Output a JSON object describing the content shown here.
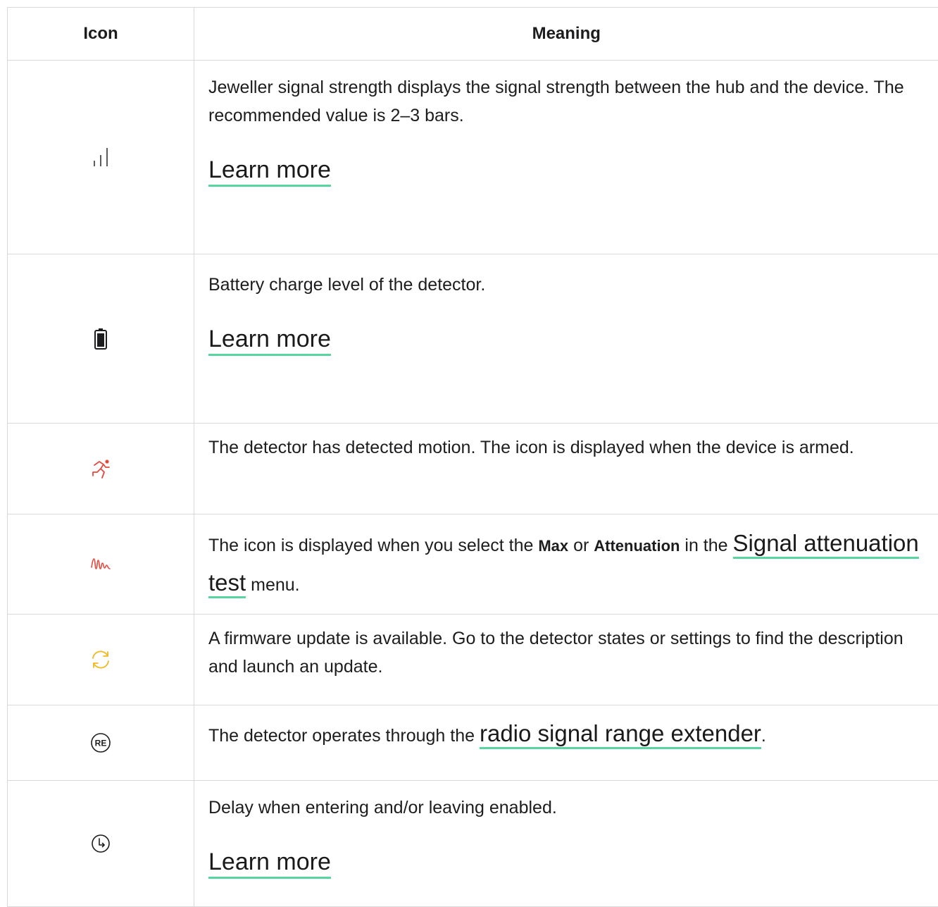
{
  "table": {
    "headers": {
      "icon": "Icon",
      "meaning": "Meaning"
    },
    "rows": [
      {
        "icon": "signal-strength-icon",
        "text": "Jeweller signal strength displays the signal strength between the hub and the device. The recommended value is 2–3 bars.",
        "link": "Learn more"
      },
      {
        "icon": "battery-icon",
        "text": "Battery charge level of the detector.",
        "link": "Learn more"
      },
      {
        "icon": "motion-detected-icon",
        "text": "The detector has detected motion. The icon is displayed when the device is armed."
      },
      {
        "icon": "signal-attenuation-icon",
        "text_before": "The icon is displayed when you select the ",
        "bold1": "Max",
        "text_middle": " or ",
        "bold2": "Attenuation",
        "text_after_bold": " in the ",
        "link": "Signal attenuation test",
        "text_end": " menu."
      },
      {
        "icon": "firmware-update-icon",
        "text": "A firmware update is available. Go to the detector states or settings to find the description and launch an update."
      },
      {
        "icon": "range-extender-icon",
        "icon_text": "RE",
        "text_before": "The detector operates through the ",
        "link": "radio signal range extender",
        "text_end": "."
      },
      {
        "icon": "delay-timer-icon",
        "text": "Delay when entering and/or leaving enabled.",
        "link": "Learn more"
      }
    ]
  },
  "colors": {
    "link_underline": "#59d5a2",
    "alert_red": "#e5483f",
    "update_yellow": "#f2b824",
    "grid": "#d9d9d9"
  }
}
